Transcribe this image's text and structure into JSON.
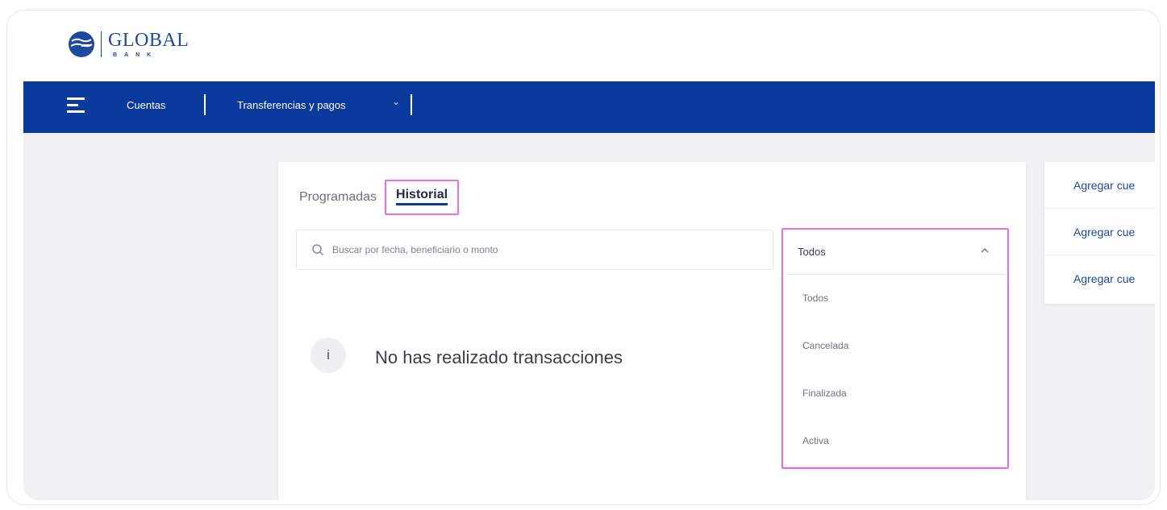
{
  "brand": {
    "name": "GLOBAL",
    "subname": "BANK"
  },
  "nav": {
    "items": [
      {
        "label": "Cuentas"
      },
      {
        "label": "Transferencias y pagos"
      }
    ]
  },
  "tabs": [
    {
      "label": "Programadas",
      "active": false
    },
    {
      "label": "Historial",
      "active": true
    }
  ],
  "search": {
    "placeholder": "Buscar por fecha, beneficiario o monto"
  },
  "filter": {
    "selected": "Todos",
    "options": [
      "Todos",
      "Cancelada",
      "Finalizada",
      "Activa"
    ]
  },
  "empty_state": {
    "icon": "i",
    "message": "No has realizado transacciones"
  },
  "side_links": [
    "Agregar cue",
    "Agregar cue",
    "Agregar cue"
  ],
  "colors": {
    "nav_bg": "#0a3a9e",
    "brand_blue": "#1d4aa0",
    "highlight": "#e96ee6"
  }
}
